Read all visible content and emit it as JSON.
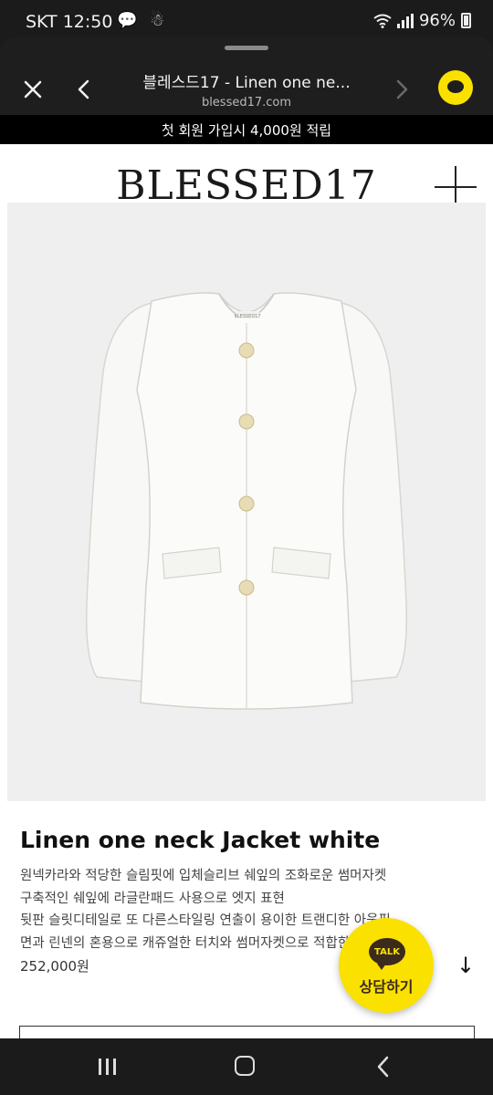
{
  "status_bar": {
    "carrier_time": "SKT 12:50",
    "battery": "96%",
    "notification_icons": [
      "chat-bubble-icon",
      "app-notification-icon"
    ]
  },
  "browser": {
    "page_title": "블레스드17 - Linen one ne...",
    "url": "blessed17.com",
    "icons": [
      "close-icon",
      "back-chevron-icon",
      "forward-chevron-icon",
      "kakaotalk-share-icon"
    ]
  },
  "banner": {
    "text": "첫 회원 가입시 4,000원 적립"
  },
  "site": {
    "logo": "BLESSED17"
  },
  "product": {
    "name": "Linen one neck Jacket white",
    "description_lines": [
      "원넥카라와 적당한 슬림핏에 입체슬리브 쉐잎의 조화로운 썸머자켓",
      "구축적인 쉐잎에 라글란패드 사용으로 엣지 표현",
      "뒷판 슬릿디테일로 또 다른스타일링 연출이 용이한 트랜디한 아웃핏",
      "면과 린넨의 혼용으로 캐쥬얼한 터치와 썸머자켓으로 적합한 아이템"
    ],
    "price": "252,000원",
    "image_label_tag": "BLESSED17"
  },
  "kakao": {
    "bubble": "TALK",
    "label": "상담하기"
  },
  "colors": {
    "kakao_yellow": "#fae100",
    "dark_bar": "#1b1b1b",
    "banner_bg": "#000000"
  }
}
